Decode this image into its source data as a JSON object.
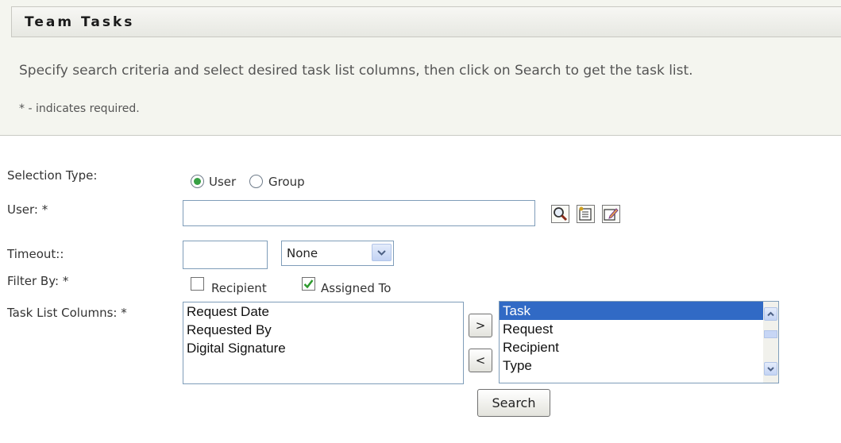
{
  "header": {
    "title": "Team Tasks",
    "instruction": "Specify search criteria and select desired task list columns, then click on Search to get the task list.",
    "required_note": "* - indicates required."
  },
  "form": {
    "selection_type": {
      "label": "Selection Type:",
      "options": [
        "User",
        "Group"
      ],
      "selected": "User"
    },
    "user": {
      "label": "User: *",
      "value": "",
      "icons": [
        "search-icon",
        "history-icon",
        "edit-icon"
      ]
    },
    "timeout": {
      "label": "Timeout::",
      "value": "",
      "select_value": "None"
    },
    "filter_by": {
      "label": "Filter By: *",
      "options": [
        {
          "label": "Recipient",
          "checked": false
        },
        {
          "label": "Assigned To",
          "checked": true
        }
      ]
    },
    "task_list_columns": {
      "label": "Task List Columns: *",
      "available": [
        "Request Date",
        "Requested By",
        "Digital Signature"
      ],
      "selected": [
        "Task",
        "Request",
        "Recipient",
        "Type"
      ],
      "highlighted": "Task",
      "add_label": ">",
      "remove_label": "<"
    },
    "search_label": "Search"
  },
  "colors": {
    "panel_bg": "#f4f5ef",
    "selection_blue": "#316ac5",
    "radio_green": "#37a043",
    "check_green": "#2e9a2e"
  }
}
